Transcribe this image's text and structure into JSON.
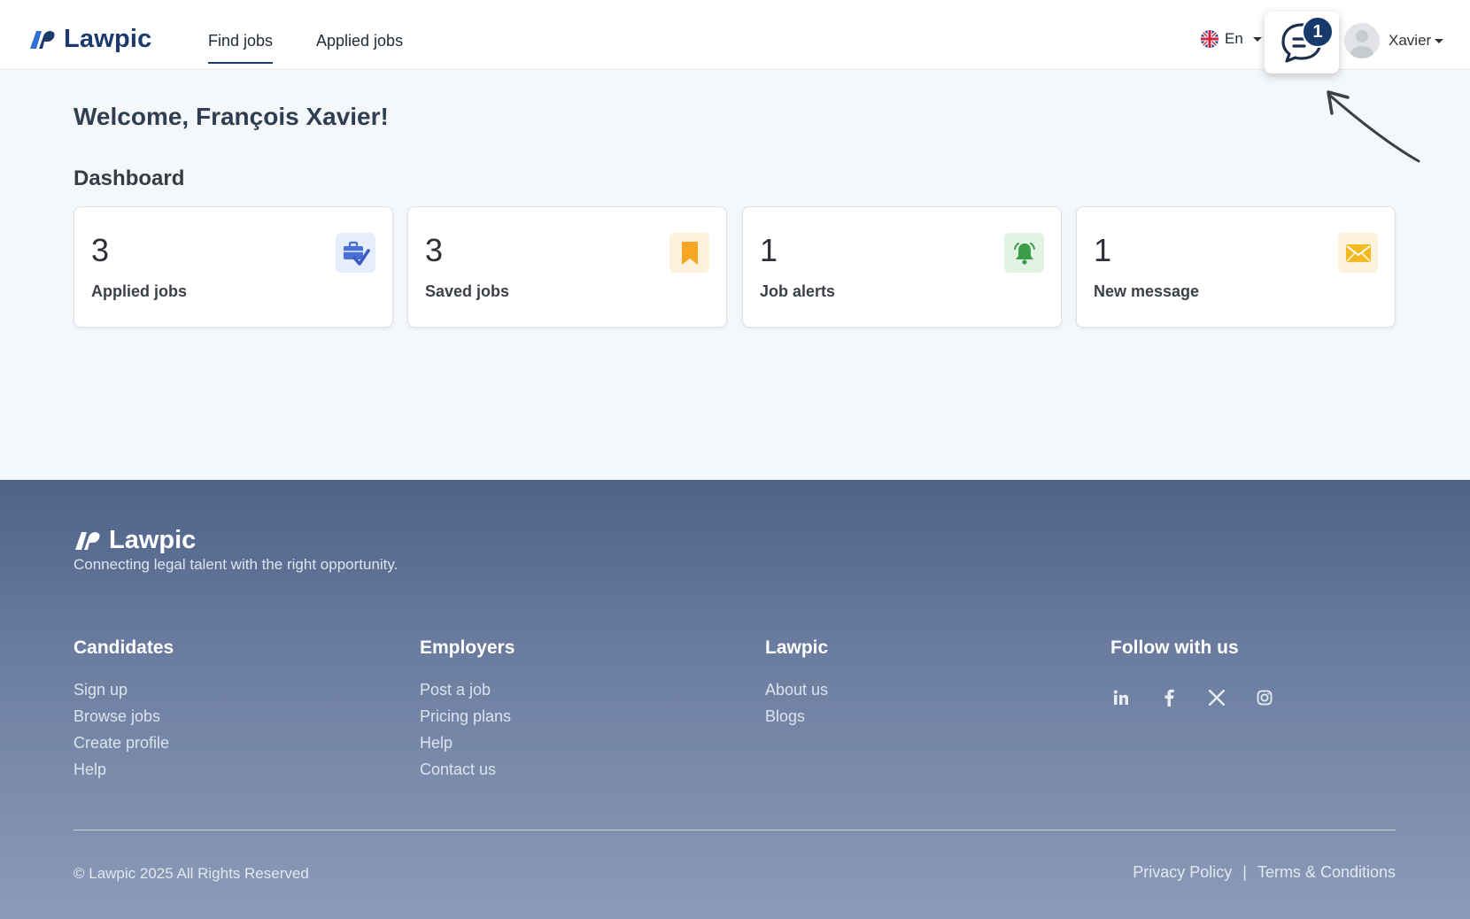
{
  "header": {
    "brand": "Lawpic",
    "tabs": [
      {
        "label": "Find jobs",
        "active": true
      },
      {
        "label": "Applied jobs",
        "active": false
      }
    ],
    "language": "En",
    "messages_badge": "1",
    "user_name": "Xavier"
  },
  "main": {
    "welcome": "Welcome, François Xavier!",
    "dashboard_title": "Dashboard",
    "cards": [
      {
        "count": "3",
        "label": "Applied jobs",
        "icon": "briefcase-check-icon",
        "icon_color": "#4a6fd6",
        "icon_bg": "#e6edfb"
      },
      {
        "count": "3",
        "label": "Saved jobs",
        "icon": "bookmark-icon",
        "icon_color": "#f5a623",
        "icon_bg": "#fdf1dc"
      },
      {
        "count": "1",
        "label": "Job alerts",
        "icon": "bell-icon",
        "icon_color": "#3a9e4a",
        "icon_bg": "#e2f3e4"
      },
      {
        "count": "1",
        "label": "New message",
        "icon": "envelope-icon",
        "icon_color": "#f5b921",
        "icon_bg": "#fdf3dc"
      }
    ]
  },
  "footer": {
    "brand": "Lawpic",
    "tagline": "Connecting legal talent with the right opportunity.",
    "columns": [
      {
        "title": "Candidates",
        "links": [
          "Sign up",
          "Browse jobs",
          "Create profile",
          "Help"
        ]
      },
      {
        "title": "Employers",
        "links": [
          "Post a job",
          "Pricing plans",
          "Help",
          "Contact us"
        ]
      },
      {
        "title": "Lawpic",
        "links": [
          "About us",
          "Blogs"
        ]
      },
      {
        "title": "Follow with us",
        "links": []
      }
    ],
    "socials": [
      "linkedin-icon",
      "facebook-icon",
      "x-icon",
      "instagram-icon"
    ],
    "copyright": "© Lawpic 2025 All Rights Reserved",
    "privacy": "Privacy Policy",
    "separator": "|",
    "terms": "Terms & Conditions"
  }
}
